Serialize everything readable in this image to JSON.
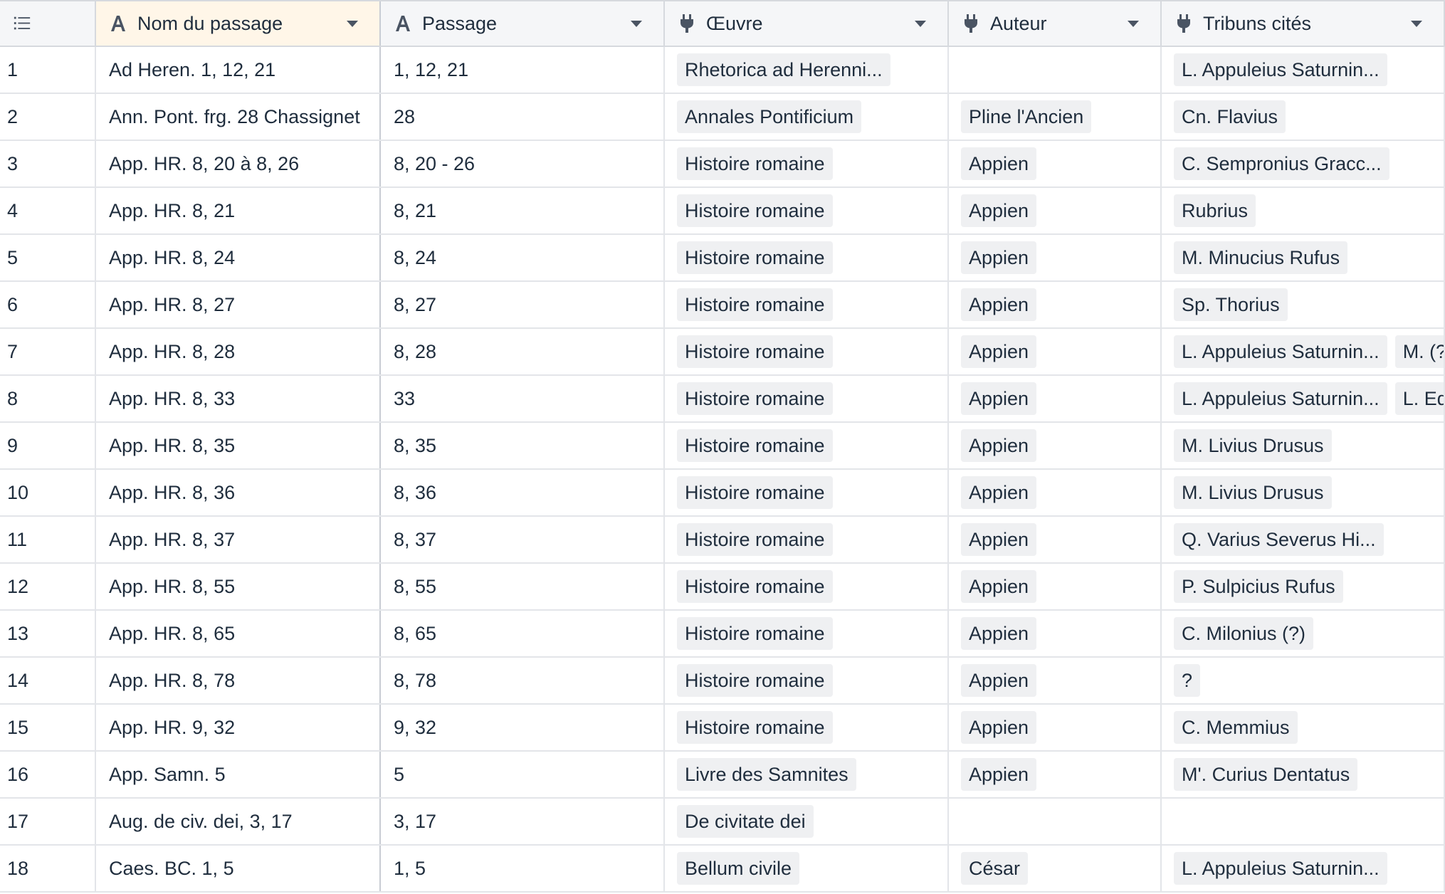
{
  "columns": [
    {
      "id": "row",
      "label": "",
      "icon": "row-number-icon"
    },
    {
      "id": "nom",
      "label": "Nom du passage",
      "icon": "text-field-icon"
    },
    {
      "id": "passage",
      "label": "Passage",
      "icon": "text-field-icon"
    },
    {
      "id": "oeuvre",
      "label": "Œuvre",
      "icon": "link-field-icon"
    },
    {
      "id": "auteur",
      "label": "Auteur",
      "icon": "link-field-icon"
    },
    {
      "id": "tribuns",
      "label": "Tribuns cités",
      "icon": "link-field-icon"
    }
  ],
  "rows": [
    {
      "n": "1",
      "nom": "Ad Heren. 1, 12, 21",
      "passage": "1, 12, 21",
      "oeuvre": [
        "Rhetorica ad Herenni..."
      ],
      "auteur": [],
      "tribuns": [
        "L. Appuleius Saturnin..."
      ]
    },
    {
      "n": "2",
      "nom": "Ann. Pont. frg. 28 Chassignet",
      "passage": "28",
      "oeuvre": [
        "Annales Pontificium"
      ],
      "auteur": [
        "Pline l'Ancien"
      ],
      "tribuns": [
        "Cn. Flavius"
      ]
    },
    {
      "n": "3",
      "nom": "App. HR. 8, 20 à 8, 26",
      "passage": "8, 20 - 26",
      "oeuvre": [
        "Histoire romaine"
      ],
      "auteur": [
        "Appien"
      ],
      "tribuns": [
        "C. Sempronius Gracc..."
      ]
    },
    {
      "n": "4",
      "nom": "App. HR. 8, 21",
      "passage": "8, 21",
      "oeuvre": [
        "Histoire romaine"
      ],
      "auteur": [
        "Appien"
      ],
      "tribuns": [
        "Rubrius"
      ]
    },
    {
      "n": "5",
      "nom": "App. HR. 8, 24",
      "passage": "8, 24",
      "oeuvre": [
        "Histoire romaine"
      ],
      "auteur": [
        "Appien"
      ],
      "tribuns": [
        "M. Minucius Rufus"
      ]
    },
    {
      "n": "6",
      "nom": "App. HR. 8, 27",
      "passage": "8, 27",
      "oeuvre": [
        "Histoire romaine"
      ],
      "auteur": [
        "Appien"
      ],
      "tribuns": [
        "Sp. Thorius"
      ]
    },
    {
      "n": "7",
      "nom": "App. HR. 8, 28",
      "passage": "8, 28",
      "oeuvre": [
        "Histoire romaine"
      ],
      "auteur": [
        "Appien"
      ],
      "tribuns": [
        "L. Appuleius Saturnin...",
        "M. (?"
      ]
    },
    {
      "n": "8",
      "nom": "App. HR. 8, 33",
      "passage": "33",
      "oeuvre": [
        "Histoire romaine"
      ],
      "auteur": [
        "Appien"
      ],
      "tribuns": [
        "L. Appuleius Saturnin...",
        "L. Eq"
      ]
    },
    {
      "n": "9",
      "nom": "App. HR. 8, 35",
      "passage": "8, 35",
      "oeuvre": [
        "Histoire romaine"
      ],
      "auteur": [
        "Appien"
      ],
      "tribuns": [
        "M. Livius Drusus"
      ]
    },
    {
      "n": "10",
      "nom": "App. HR. 8, 36",
      "passage": "8, 36",
      "oeuvre": [
        "Histoire romaine"
      ],
      "auteur": [
        "Appien"
      ],
      "tribuns": [
        "M. Livius Drusus"
      ]
    },
    {
      "n": "11",
      "nom": "App. HR. 8, 37",
      "passage": "8, 37",
      "oeuvre": [
        "Histoire romaine"
      ],
      "auteur": [
        "Appien"
      ],
      "tribuns": [
        "Q. Varius Severus Hi..."
      ]
    },
    {
      "n": "12",
      "nom": "App. HR. 8, 55",
      "passage": "8, 55",
      "oeuvre": [
        "Histoire romaine"
      ],
      "auteur": [
        "Appien"
      ],
      "tribuns": [
        "P. Sulpicius Rufus"
      ]
    },
    {
      "n": "13",
      "nom": "App. HR. 8, 65",
      "passage": "8, 65",
      "oeuvre": [
        "Histoire romaine"
      ],
      "auteur": [
        "Appien"
      ],
      "tribuns": [
        "C. Milonius (?)"
      ]
    },
    {
      "n": "14",
      "nom": "App. HR. 8, 78",
      "passage": "8, 78",
      "oeuvre": [
        "Histoire romaine"
      ],
      "auteur": [
        "Appien"
      ],
      "tribuns": [
        "?"
      ]
    },
    {
      "n": "15",
      "nom": "App. HR. 9, 32",
      "passage": "9, 32",
      "oeuvre": [
        "Histoire romaine"
      ],
      "auteur": [
        "Appien"
      ],
      "tribuns": [
        "C. Memmius"
      ]
    },
    {
      "n": "16",
      "nom": "App. Samn. 5",
      "passage": "5",
      "oeuvre": [
        "Livre des Samnites"
      ],
      "auteur": [
        "Appien"
      ],
      "tribuns": [
        "M'. Curius Dentatus"
      ]
    },
    {
      "n": "17",
      "nom": "Aug. de civ. dei, 3, 17",
      "passage": "3, 17",
      "oeuvre": [
        "De civitate dei"
      ],
      "auteur": [],
      "tribuns": []
    },
    {
      "n": "18",
      "nom": "Caes. BC. 1, 5",
      "passage": "1, 5",
      "oeuvre": [
        "Bellum civile"
      ],
      "auteur": [
        "César"
      ],
      "tribuns": [
        "L. Appuleius Saturnin..."
      ]
    }
  ]
}
